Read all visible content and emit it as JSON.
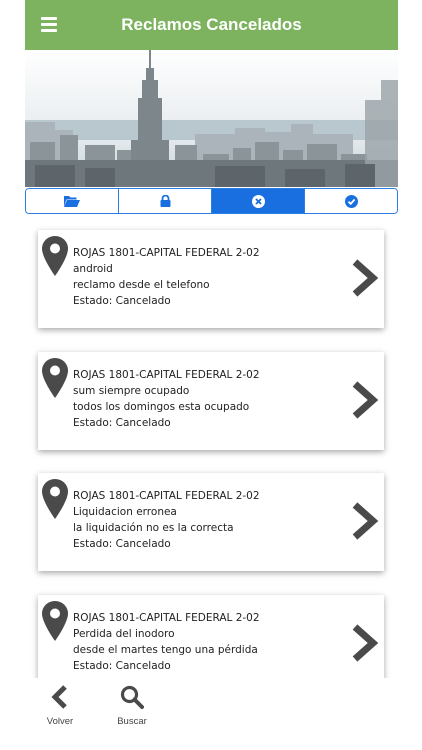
{
  "header": {
    "title": "Reclamos Cancelados",
    "menu_icon": "hamburger-icon"
  },
  "colors": {
    "header_bg": "#7db35f",
    "tab_accent": "#1a6fe0",
    "icon_dark": "#4a4a4a"
  },
  "tabs": [
    {
      "icon": "folder-open-icon",
      "active": false
    },
    {
      "icon": "lock-icon",
      "active": false
    },
    {
      "icon": "times-circle-icon",
      "active": true
    },
    {
      "icon": "check-circle-icon",
      "active": false
    }
  ],
  "claims": [
    {
      "address": "ROJAS 1801-CAPITAL FEDERAL 2-02",
      "subject": "android",
      "description": "reclamo desde el telefono",
      "status": "Estado: Cancelado"
    },
    {
      "address": "ROJAS 1801-CAPITAL FEDERAL 2-02",
      "subject": "sum siempre ocupado",
      "description": "todos los domingos esta ocupado",
      "status": "Estado: Cancelado"
    },
    {
      "address": "ROJAS 1801-CAPITAL FEDERAL 2-02",
      "subject": "Liquidacion erronea",
      "description": "la liquidación no es la correcta",
      "status": "Estado: Cancelado"
    },
    {
      "address": "ROJAS 1801-CAPITAL FEDERAL 2-02",
      "subject": "Perdida del inodoro",
      "description": "desde el martes tengo una pérdida",
      "status": "Estado: Cancelado"
    }
  ],
  "bottom_nav": [
    {
      "label": "Volver",
      "icon": "chevron-left-icon"
    },
    {
      "label": "Buscar",
      "icon": "search-icon"
    }
  ]
}
